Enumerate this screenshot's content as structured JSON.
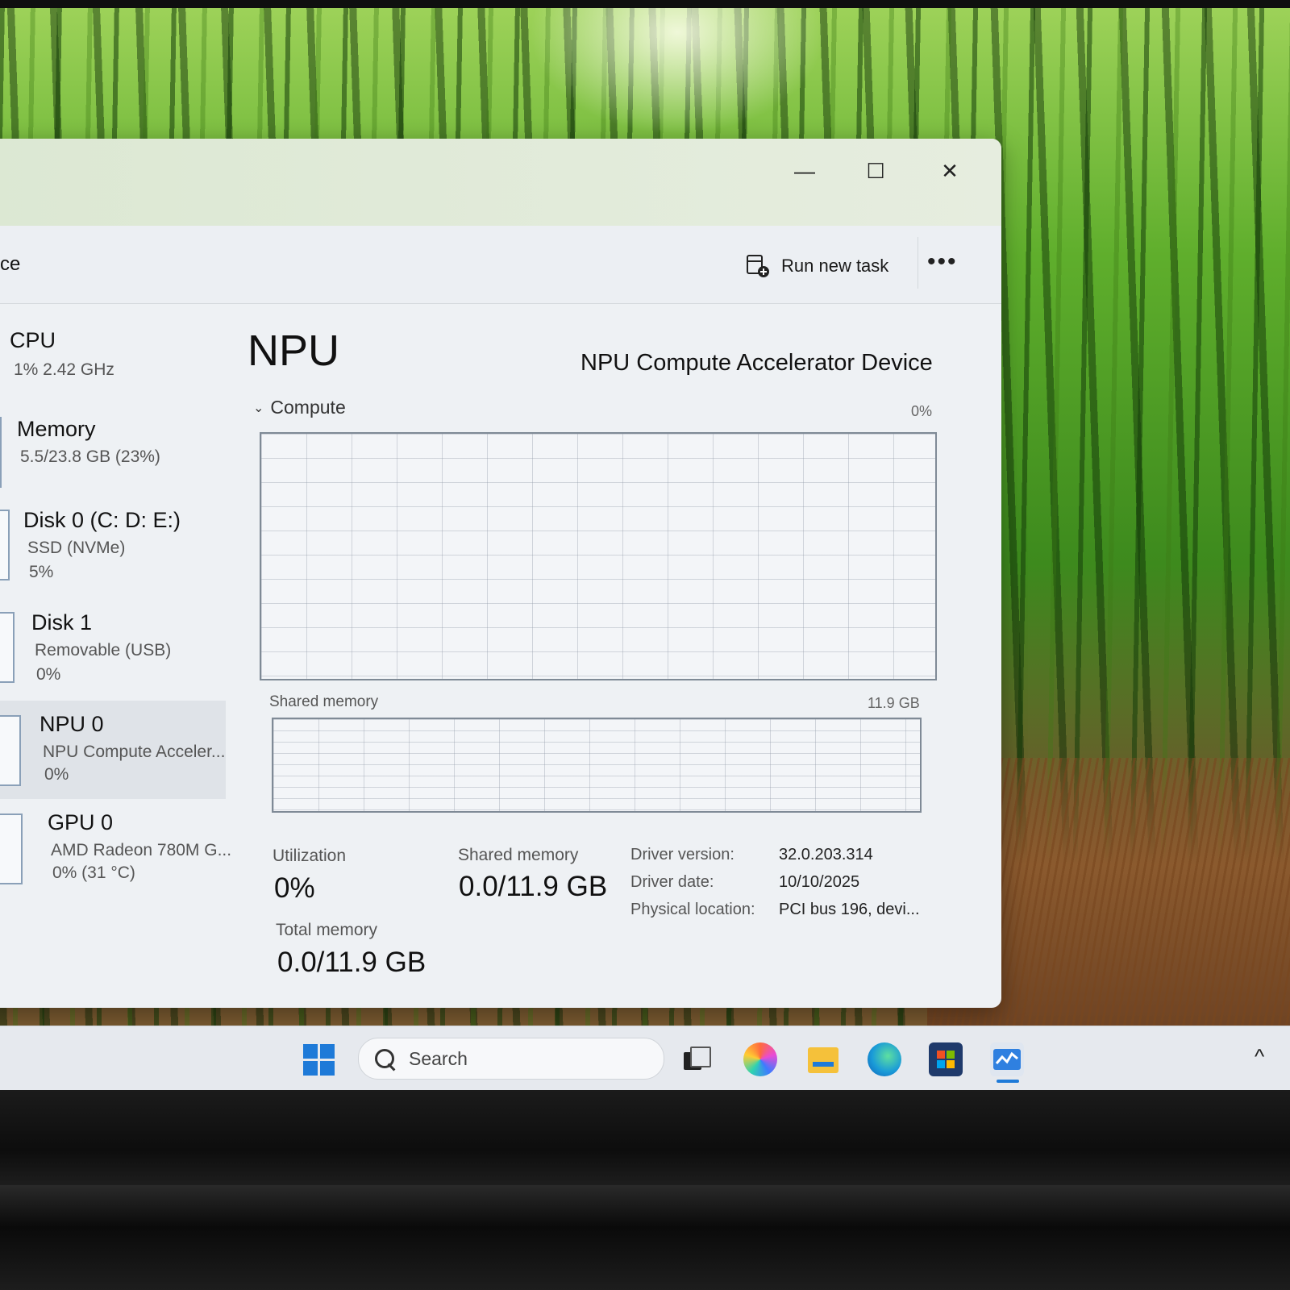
{
  "window": {
    "breadcrumb": "ce",
    "controls": {
      "minimize": "—",
      "maximize": "☐",
      "close": "✕"
    },
    "toolbar": {
      "run_new_task": "Run new task",
      "more": "•••"
    }
  },
  "sidebar": {
    "items": [
      {
        "title": "CPU",
        "sub1": "1%  2.42 GHz",
        "sub2": ""
      },
      {
        "title": "Memory",
        "sub1": "5.5/23.8 GB (23%)",
        "sub2": ""
      },
      {
        "title": "Disk 0 (C: D: E:)",
        "sub1": "SSD (NVMe)",
        "sub2": "5%"
      },
      {
        "title": "Disk 1",
        "sub1": "Removable (USB)",
        "sub2": "0%"
      },
      {
        "title": "NPU 0",
        "sub1": "NPU Compute Acceler...",
        "sub2": "0%"
      },
      {
        "title": "GPU 0",
        "sub1": "AMD Radeon 780M G...",
        "sub2": "0%  (31 °C)"
      }
    ]
  },
  "main": {
    "title": "NPU",
    "device_name": "NPU Compute Accelerator Device",
    "compute_label": "Compute",
    "compute_pct": "0%",
    "shared_label": "Shared memory",
    "shared_max": "11.9 GB",
    "stats": {
      "utilization_label": "Utilization",
      "utilization_value": "0%",
      "shared_memory_label": "Shared memory",
      "shared_memory_value": "0.0/11.9 GB",
      "total_memory_label": "Total memory",
      "total_memory_value": "0.0/11.9 GB"
    },
    "driver": {
      "version_label": "Driver version:",
      "version_value": "32.0.203.314",
      "date_label": "Driver date:",
      "date_value": "10/10/2025",
      "location_label": "Physical location:",
      "location_value": "PCI bus 196, devi..."
    }
  },
  "taskbar": {
    "search_placeholder": "Search",
    "tray_chevron": "^",
    "icons": [
      "windows-start-icon",
      "task-view-icon",
      "copilot-icon",
      "file-explorer-icon",
      "edge-icon",
      "store-icon",
      "task-manager-icon"
    ],
    "accent": "#1e7ad8"
  }
}
